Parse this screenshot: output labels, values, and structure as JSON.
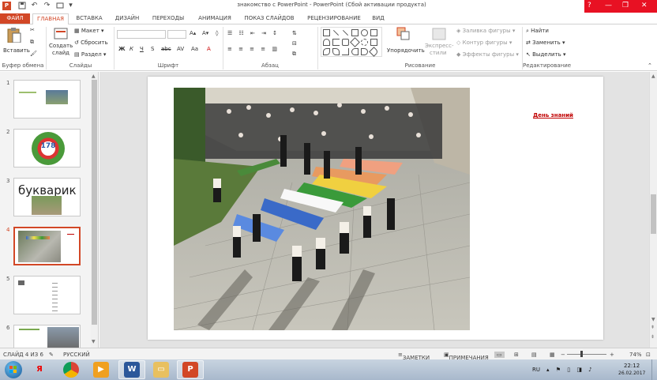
{
  "titlebar": {
    "title": "знакомство с PowerPoint - PowerPoint (Сбой активации продукта)",
    "logo_letter": "P",
    "help": "?",
    "minimize": "—",
    "maximize": "❐",
    "close": "✕"
  },
  "tabs": {
    "file": "ФАЙЛ",
    "home": "ГЛАВНАЯ",
    "insert": "ВСТАВКА",
    "design": "ДИЗАЙН",
    "transitions": "ПЕРЕХОДЫ",
    "animation": "АНИМАЦИЯ",
    "slideshow": "ПОКАЗ СЛАЙДОВ",
    "review": "РЕЦЕНЗИРОВАНИЕ",
    "view": "ВИД"
  },
  "ribbon": {
    "clipboard": {
      "paste": "Вставить",
      "label": "Буфер обмена"
    },
    "slides": {
      "new_slide_1": "Создать",
      "new_slide_2": "слайд",
      "layout": "Макет",
      "reset": "Сбросить",
      "section": "Раздел",
      "label": "Слайды"
    },
    "font": {
      "bold": "Ж",
      "italic": "К",
      "underline": "Ч",
      "strike": "S",
      "spacing": "abc",
      "label": "Шрифт"
    },
    "paragraph": {
      "label": "Абзац"
    },
    "drawing": {
      "arrange": "Упорядочить",
      "quick_styles_1": "Экспресс-",
      "quick_styles_2": "стили",
      "fill": "Заливка фигуры",
      "outline": "Контур фигуры",
      "effects": "Эффекты фигуры",
      "label": "Рисование"
    },
    "editing": {
      "find": "Найти",
      "replace": "Заменить",
      "select": "Выделить",
      "label": "Редактирование"
    }
  },
  "thumbnails": [
    {
      "num": "1"
    },
    {
      "num": "2",
      "badge": "178"
    },
    {
      "num": "3",
      "title": "букварик"
    },
    {
      "num": "4"
    },
    {
      "num": "5"
    },
    {
      "num": "6"
    }
  ],
  "slide": {
    "link_text": "День знаний"
  },
  "statusbar": {
    "slide_info": "СЛАЙД 4 ИЗ 6",
    "language": "РУССКИЙ",
    "notes": "ЗАМЕТКИ",
    "comments": "ПРИМЕЧАНИЯ",
    "zoom_percent": "74%",
    "zoom_level": 0.74
  },
  "taskbar": {
    "lang": "RU",
    "time": "22:12",
    "date": "26.02.2017",
    "yandex": "Я",
    "word": "W",
    "ppt": "P"
  },
  "colors": {
    "accent": "#d24726",
    "close": "#e81123",
    "link": "#c00000"
  }
}
